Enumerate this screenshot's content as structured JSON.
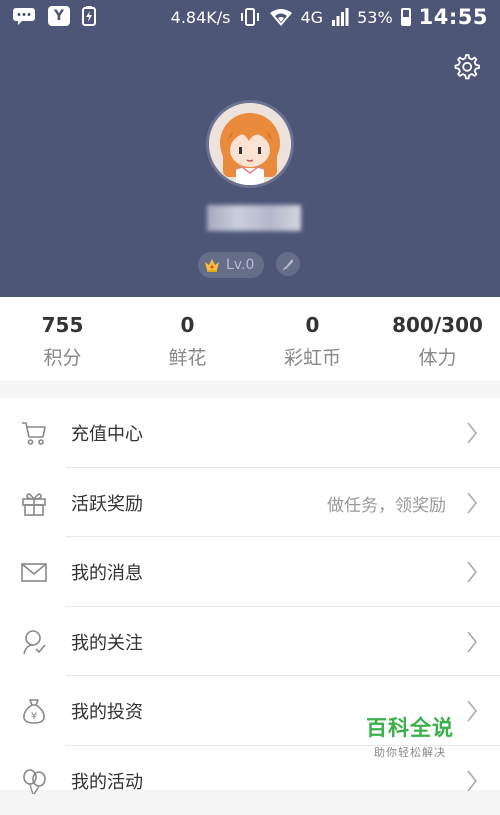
{
  "status_bar": {
    "app_icon_letter": "Y",
    "network_speed": "4.84K/s",
    "network_type": "4G",
    "battery_percent": "53%",
    "battery_level": 0.53,
    "time": "14:55"
  },
  "profile": {
    "level": "Lv.0"
  },
  "stats": [
    {
      "value": "755",
      "label": "积分"
    },
    {
      "value": "0",
      "label": "鲜花"
    },
    {
      "value": "0",
      "label": "彩虹币"
    },
    {
      "value": "800/300",
      "label": "体力"
    }
  ],
  "menu": [
    {
      "label": "充值中心",
      "icon": "cart-icon",
      "note": ""
    },
    {
      "label": "活跃奖励",
      "icon": "gift-icon",
      "note": "做任务，领奖励"
    },
    {
      "label": "我的消息",
      "icon": "envelope-icon",
      "note": ""
    },
    {
      "label": "我的关注",
      "icon": "follow-icon",
      "note": ""
    },
    {
      "label": "我的投资",
      "icon": "money-bag-icon",
      "note": ""
    },
    {
      "label": "我的活动",
      "icon": "balloons-icon",
      "note": ""
    }
  ],
  "watermark": {
    "title": "百科全说",
    "subtitle": "助你轻松解决"
  },
  "colors": {
    "header_bg": "#4e5677",
    "page_bg": "#f5f5f5",
    "watermark_green": "#3bb04a"
  }
}
